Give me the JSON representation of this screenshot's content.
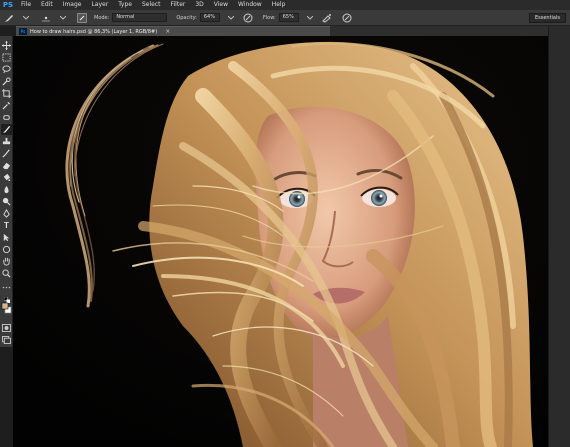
{
  "menubar": {
    "logo": "PS",
    "items": [
      "File",
      "Edit",
      "Image",
      "Layer",
      "Type",
      "Select",
      "Filter",
      "3D",
      "View",
      "Window",
      "Help"
    ]
  },
  "options": {
    "mode_label": "Mode:",
    "mode_value": "Normal",
    "opacity_label": "Opacity:",
    "opacity_value": "64%",
    "flow_label": "Flow:",
    "flow_value": "65%",
    "workspace": "Essentials"
  },
  "document": {
    "tab_title": "How to draw hairs.psd @ 86,3% (Layer 1, RGB/8#)",
    "tab_badge": "Ps",
    "close": "×"
  },
  "toolbar": {
    "type_tool": "T"
  },
  "colors": {
    "accent": "#31a8ff",
    "background": "#050505",
    "hair_light": "#f2d3a0",
    "hair_mid": "#c0925a",
    "skin": "#e8b89a",
    "eyes": "#8aa7b5"
  }
}
